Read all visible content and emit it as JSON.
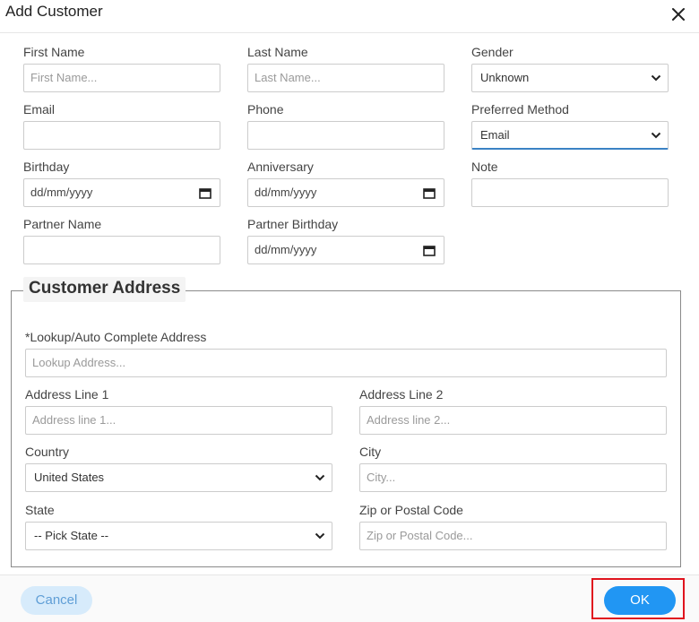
{
  "dialog": {
    "title": "Add Customer"
  },
  "form": {
    "first_name": {
      "label": "First Name",
      "placeholder": "First Name..."
    },
    "last_name": {
      "label": "Last Name",
      "placeholder": "Last Name..."
    },
    "gender": {
      "label": "Gender",
      "value": "Unknown"
    },
    "email": {
      "label": "Email",
      "value": ""
    },
    "phone": {
      "label": "Phone",
      "value": ""
    },
    "preferred_method": {
      "label": "Preferred Method",
      "value": "Email"
    },
    "birthday": {
      "label": "Birthday",
      "value": "dd/mm/yyyy"
    },
    "anniversary": {
      "label": "Anniversary",
      "value": "dd/mm/yyyy"
    },
    "note": {
      "label": "Note",
      "value": ""
    },
    "partner_name": {
      "label": "Partner Name",
      "value": ""
    },
    "partner_birthday": {
      "label": "Partner Birthday",
      "value": "dd/mm/yyyy"
    }
  },
  "address": {
    "legend": "Customer Address",
    "lookup": {
      "label": "*Lookup/Auto Complete Address",
      "placeholder": "Lookup Address..."
    },
    "line1": {
      "label": "Address Line 1",
      "placeholder": "Address line 1..."
    },
    "line2": {
      "label": "Address Line 2",
      "placeholder": "Address line 2..."
    },
    "country": {
      "label": "Country",
      "value": "United States"
    },
    "city": {
      "label": "City",
      "placeholder": "City..."
    },
    "state": {
      "label": "State",
      "value": "-- Pick State --"
    },
    "zip": {
      "label": "Zip or Postal Code",
      "placeholder": "Zip or Postal Code..."
    }
  },
  "footer": {
    "cancel_label": "Cancel",
    "ok_label": "OK"
  },
  "colors": {
    "primary": "#2196f3",
    "highlight": "#e0141e",
    "cancel_bg": "#d7ebfb"
  },
  "icons": {
    "close": "close-icon",
    "calendar": "calendar-icon",
    "dropdown": "chevron-down-icon"
  }
}
